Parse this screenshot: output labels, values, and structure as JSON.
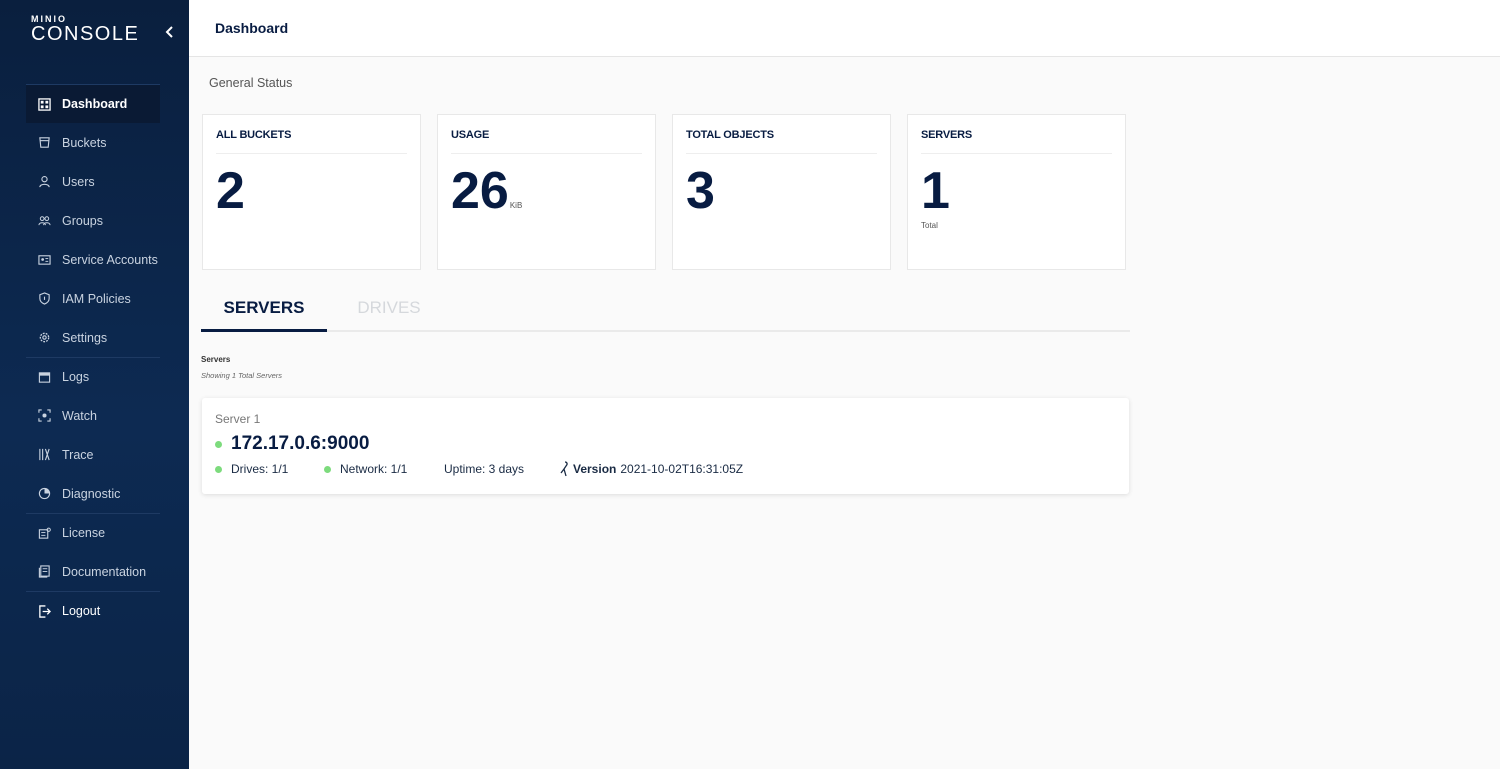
{
  "logo": {
    "small": "MINIO",
    "big": "CONSOLE"
  },
  "nav": {
    "items": [
      {
        "label": "Dashboard",
        "icon": "dashboard-icon"
      },
      {
        "label": "Buckets",
        "icon": "bucket-icon"
      },
      {
        "label": "Users",
        "icon": "user-icon"
      },
      {
        "label": "Groups",
        "icon": "groups-icon"
      },
      {
        "label": "Service Accounts",
        "icon": "service-accounts-icon"
      },
      {
        "label": "IAM Policies",
        "icon": "shield-icon"
      },
      {
        "label": "Settings",
        "icon": "gear-icon"
      },
      {
        "label": "Logs",
        "icon": "logs-icon"
      },
      {
        "label": "Watch",
        "icon": "watch-icon"
      },
      {
        "label": "Trace",
        "icon": "trace-icon"
      },
      {
        "label": "Diagnostic",
        "icon": "diagnostic-icon"
      },
      {
        "label": "License",
        "icon": "license-icon"
      },
      {
        "label": "Documentation",
        "icon": "documentation-icon"
      },
      {
        "label": "Logout",
        "icon": "logout-icon"
      }
    ]
  },
  "header": {
    "title": "Dashboard"
  },
  "general_status": "General Status",
  "cards": [
    {
      "title": "ALL BUCKETS",
      "value": "2",
      "unit": "",
      "sub": ""
    },
    {
      "title": "USAGE",
      "value": "26",
      "unit": "KiB",
      "sub": ""
    },
    {
      "title": "TOTAL OBJECTS",
      "value": "3",
      "unit": "",
      "sub": ""
    },
    {
      "title": "SERVERS",
      "value": "1",
      "unit": "",
      "sub": "Total"
    }
  ],
  "tabs": [
    {
      "label": "SERVERS"
    },
    {
      "label": "DRIVES"
    }
  ],
  "servers_section": {
    "label": "Servers",
    "subtitle": "Showing 1 Total Servers"
  },
  "server": {
    "name": "Server 1",
    "address": "172.17.0.6:9000",
    "drives": "Drives: 1/1",
    "network": "Network: 1/1",
    "uptime": "Uptime: 3 days",
    "version_label": "Version",
    "version": "2021-10-02T16:31:05Z"
  },
  "colors": {
    "online": "#7ddb7d",
    "brand": "#081c42",
    "sidebar": "#0d2a52"
  }
}
